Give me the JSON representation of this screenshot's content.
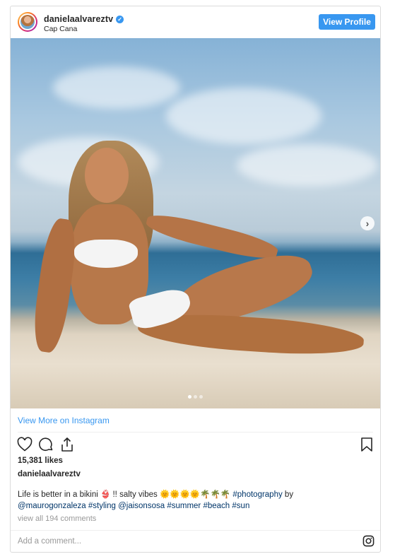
{
  "header": {
    "username": "danielaalvareztv",
    "verified_mark": "✓",
    "location": "Cap Cana",
    "view_profile_label": "View Profile"
  },
  "media": {
    "carousel_next_icon": "chevron-right-icon",
    "carousel_dots": 3,
    "active_dot": 0
  },
  "link": {
    "view_more_label": "View More on Instagram"
  },
  "actions": {
    "icons": [
      "heart-icon",
      "comment-icon",
      "share-icon",
      "bookmark-icon"
    ]
  },
  "post": {
    "likes": "15,381 likes",
    "poster": "danielaalvareztv",
    "caption_text": "Life is better in a bikini 👙 !! salty vibes 🌞🌞🌞🌞🌴🌴🌴 ",
    "caption_tag_1": "#photography",
    "caption_by": " by ",
    "caption_mention_1": "@maurogonzaleza",
    "caption_tag_2": "#styling",
    "caption_mention_2": "@jaisonsosa",
    "caption_tag_3": "#summer",
    "caption_tag_4": "#beach",
    "caption_tag_5": "#sun",
    "view_comments": "view all 194 comments"
  },
  "comment_box": {
    "placeholder": "Add a comment...",
    "brand_icon": "instagram-icon"
  },
  "colors": {
    "accent": "#3897f0",
    "tag": "#003569",
    "muted": "#999999",
    "border": "#dbdbdb"
  }
}
